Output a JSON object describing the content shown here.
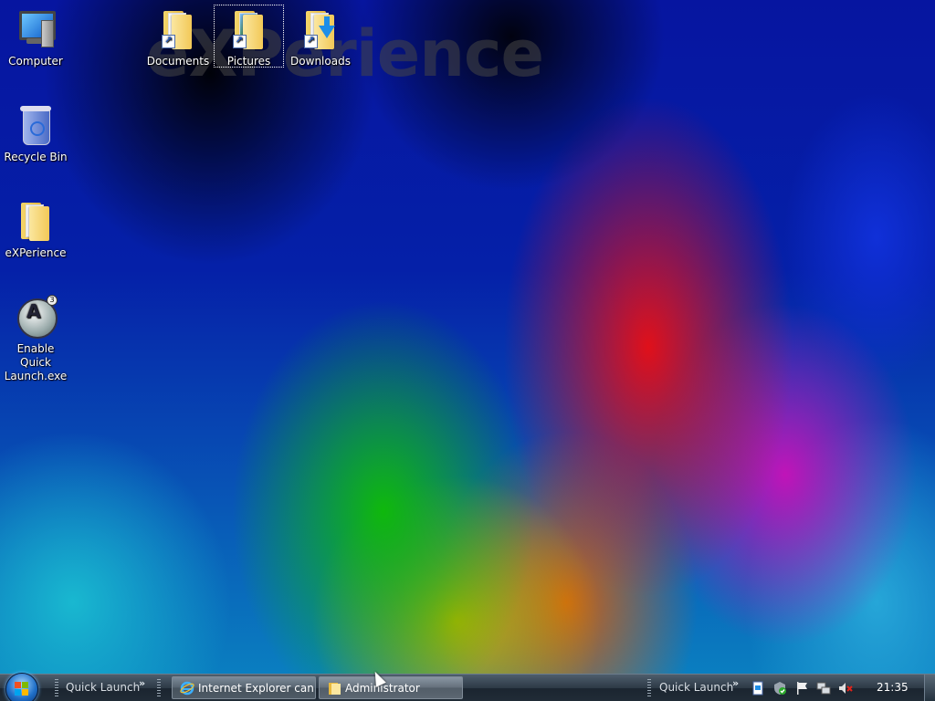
{
  "desktop": {
    "watermark": "eXPerience",
    "icons": [
      {
        "label": "Computer"
      },
      {
        "label": "Recycle Bin"
      },
      {
        "label": "eXPerience"
      },
      {
        "label": "Enable Quick Launch.exe"
      },
      {
        "label": "Documents"
      },
      {
        "label": "Pictures",
        "selected": true
      },
      {
        "label": "Downloads"
      }
    ]
  },
  "taskbar": {
    "quick_launch_left": "Quick Launch",
    "quick_launch_right": "Quick Launch",
    "chevron": "»",
    "tasks": [
      {
        "label": "Internet Explorer can..."
      },
      {
        "label": "Administrator"
      }
    ],
    "clock": "21:35"
  },
  "colors": {
    "taskbar_top": "#4d5d6c",
    "taskbar_bottom": "#1b2530",
    "accent_blue": "#1f6fc8"
  }
}
